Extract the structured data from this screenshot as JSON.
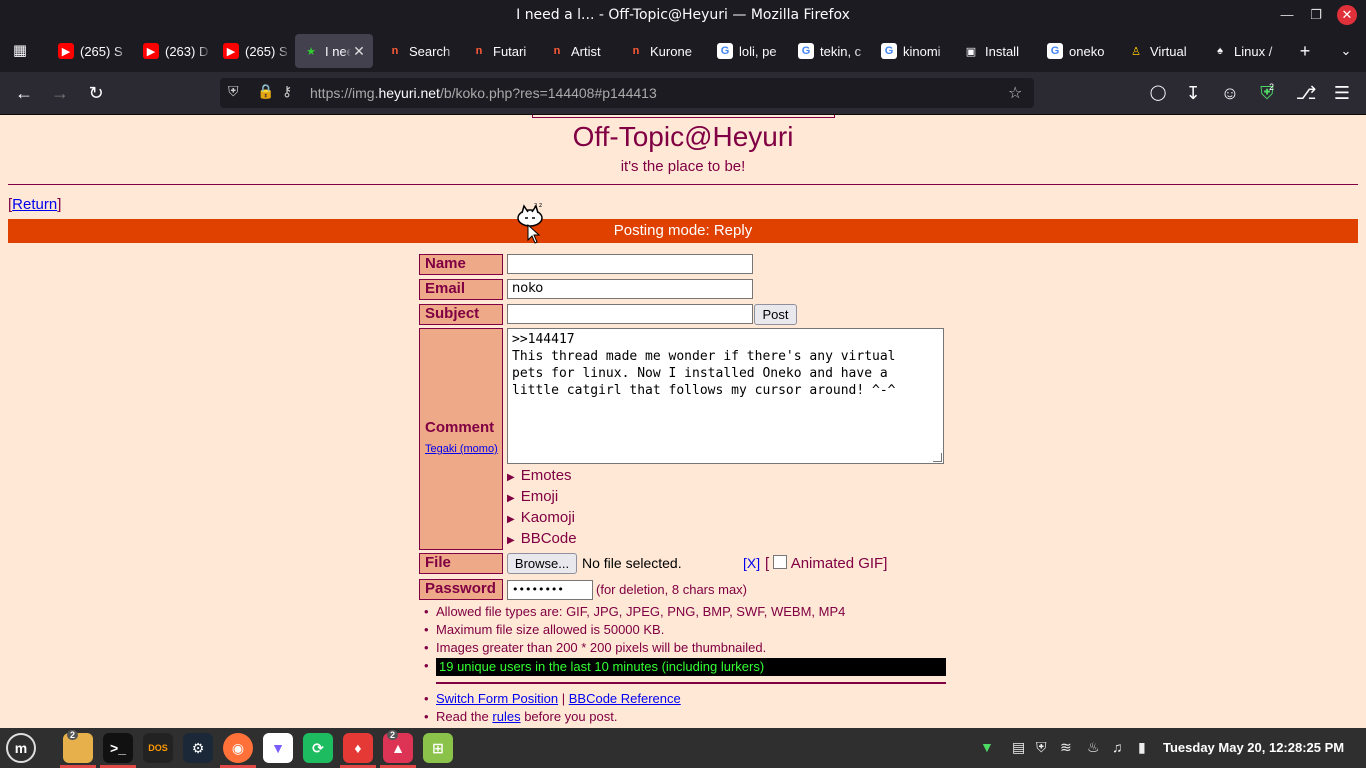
{
  "window": {
    "title": "I need a l... - Off-Topic@Heyuri — Mozilla Firefox"
  },
  "tabs": [
    {
      "label": "(265) S",
      "icon": "youtube-icon"
    },
    {
      "label": "(263) D",
      "icon": "youtube-icon"
    },
    {
      "label": "(265) S",
      "icon": "youtube-icon"
    },
    {
      "label": "I need",
      "icon": "star-icon",
      "active": true
    },
    {
      "label": "Search",
      "icon": "heyuri-icon"
    },
    {
      "label": "Futari",
      "icon": "heyuri-icon"
    },
    {
      "label": "Artist",
      "icon": "heyuri-icon"
    },
    {
      "label": "Kurone",
      "icon": "heyuri-icon"
    },
    {
      "label": "loli, pe",
      "icon": "google-icon"
    },
    {
      "label": "tekin, c",
      "icon": "google-icon"
    },
    {
      "label": "kinomi",
      "icon": "google-icon"
    },
    {
      "label": "Install",
      "icon": "apps-icon"
    },
    {
      "label": "oneko",
      "icon": "google-icon"
    },
    {
      "label": "Virtual",
      "icon": "virtual-icon"
    },
    {
      "label": "Linux /",
      "icon": "linux-icon"
    }
  ],
  "navbar": {
    "url_prefix": "https://img.",
    "url_domain": "heyuri.net",
    "url_path": "/b/koko.php?res=144408#p144413",
    "extension_badge": "2"
  },
  "page": {
    "site_title": "Off-Topic@Heyuri",
    "subtitle": "it's the place to be!",
    "return_label": "Return",
    "posting_mode": "Posting mode: Reply"
  },
  "form": {
    "name_label": "Name",
    "name_value": "",
    "email_label": "Email",
    "email_value": "noko",
    "subject_label": "Subject",
    "subject_value": "",
    "post_button": "Post",
    "comment_label": "Comment",
    "tegaki_link": "Tegaki (momo)",
    "comment_lines": [
      ">>144417",
      "This thread made me wonder if there's any virtual",
      "pets for linux. Now I installed Oneko and have a",
      "little catgirl that follows my cursor around! ^-^"
    ],
    "emotes_label": "Emotes",
    "emoji_label": "Emoji",
    "kaomoji_label": "Kaomoji",
    "bbcode_label": "BBCode",
    "file_label": "File",
    "browse_button": "Browse...",
    "file_status": "No file selected.",
    "clear_file": "[X]",
    "animated_gif_label": "Animated GIF",
    "password_label": "Password",
    "password_value": "••••••••",
    "password_hint": "(for deletion, 8 chars max)"
  },
  "rules": [
    "Allowed file types are: GIF, JPG, JPEG, PNG, BMP, SWF, WEBM, MP4",
    "Maximum file size allowed is 50000 KB.",
    "Images greater than 200 * 200 pixels will be thumbnailed.",
    "19 unique users in the last 10 minutes (including lurkers)"
  ],
  "footer_links": {
    "switch_form": "Switch Form Position",
    "separator": "|",
    "bbcode_ref": "BBCode Reference",
    "read_the": "Read the",
    "rules_link": "rules",
    "before_post": "before you post."
  },
  "taskbar": {
    "files_badge": "2",
    "photos_badge": "2",
    "clock": "Tuesday May 20, 12:28:25 PM"
  },
  "colors": {
    "page_bg": "#ffe9d6",
    "accent": "#800043",
    "mode_bar": "#e04000",
    "label_bg": "#eeaa88"
  }
}
